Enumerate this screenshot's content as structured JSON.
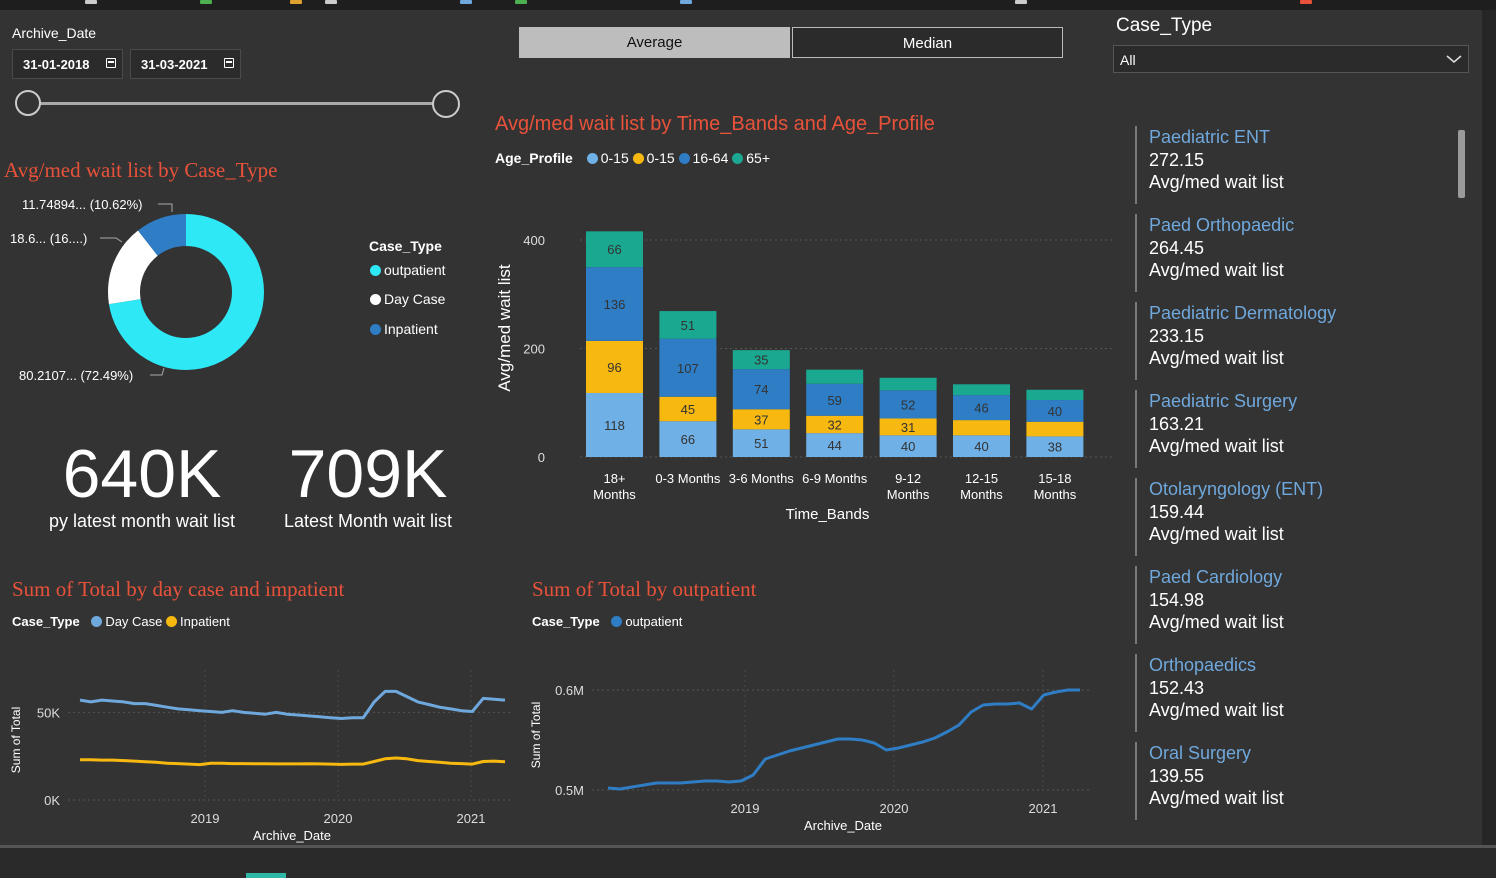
{
  "filters": {
    "archive_date_label": "Archive_Date",
    "start_date": "31-01-2018",
    "end_date": "31-03-2021",
    "toggle_average": "Average",
    "toggle_median": "Median",
    "case_type_label": "Case_Type",
    "case_type_value": "All"
  },
  "donut": {
    "title": "Avg/med wait list by Case_Type",
    "legend_title": "Case_Type",
    "legend": [
      {
        "name": "outpatient",
        "color": "#2ee8f5"
      },
      {
        "name": "Day Case",
        "color": "#ffffff"
      },
      {
        "name": "Inpatient",
        "color": "#2f7dc4"
      }
    ],
    "labels": {
      "inpatient": "11.74894... (10.62%)",
      "daycase": "18.6... (16....)",
      "outpatient": "80.2107... (72.49%)"
    }
  },
  "kpis": [
    {
      "value": "640K",
      "label": "py latest month wait list"
    },
    {
      "value": "709K",
      "label": "Latest Month wait list"
    }
  ],
  "chart_data": [
    {
      "type": "bar",
      "stacked": true,
      "title": "Avg/med wait list by Time_Bands and Age_Profile",
      "legend_title": "Age_Profile",
      "xlabel": "Time_Bands",
      "ylabel": "Avg/med wait list",
      "ylim": [
        0,
        420
      ],
      "yticks": [
        "0",
        "200",
        "400"
      ],
      "categories": [
        "18+ Months",
        "0-3 Months",
        "3-6 Months",
        "6-9 Months",
        "9-12 Months",
        "12-15 Months",
        "15-18 Months"
      ],
      "category_lines": [
        [
          "18+",
          "Months"
        ],
        [
          "0-3 Months"
        ],
        [
          "3-6 Months"
        ],
        [
          "6-9 Months"
        ],
        [
          "9-12",
          "Months"
        ],
        [
          "12-15",
          "Months"
        ],
        [
          "15-18",
          "Months"
        ]
      ],
      "series": [
        {
          "name": "0-15",
          "color": "#6fb0e6",
          "values": [
            118,
            66,
            51,
            44,
            40,
            40,
            38
          ]
        },
        {
          "name": "0-15",
          "color": "#f7b80f",
          "values": [
            96,
            45,
            37,
            32,
            31,
            28,
            27
          ]
        },
        {
          "name": "16-64",
          "color": "#2f7dc4",
          "values": [
            136,
            107,
            74,
            59,
            52,
            46,
            40
          ]
        },
        {
          "name": "65+",
          "color": "#1ba890",
          "values": [
            66,
            51,
            35,
            26,
            23,
            20,
            19
          ]
        }
      ],
      "labels": [
        [
          "118",
          "96",
          "136",
          "66"
        ],
        [
          "66",
          "45",
          "107",
          "51"
        ],
        [
          "51",
          "37",
          "74",
          "35"
        ],
        [
          "44",
          "32",
          "59",
          ""
        ],
        [
          "40",
          "31",
          "52",
          ""
        ],
        [
          "40",
          "",
          "46",
          ""
        ],
        [
          "38",
          "",
          "40",
          ""
        ]
      ],
      "grid": true
    },
    {
      "type": "line",
      "title": "Sum of Total by day case and impatient",
      "legend_title": "Case_Type",
      "xlabel": "Archive_Date",
      "ylabel": "Sum of Total",
      "ylim": [
        0,
        75000
      ],
      "yticks": [
        "0K",
        "50K"
      ],
      "xticks": [
        "2019",
        "2020",
        "2021"
      ],
      "x_start": "2018-01",
      "x_end": "2021-03",
      "series": [
        {
          "name": "Day Case",
          "color": "#6fa8dc",
          "values": [
            57000,
            56000,
            57000,
            56500,
            56000,
            55000,
            55000,
            54000,
            53000,
            52000,
            51500,
            51000,
            50500,
            50000,
            51000,
            50000,
            49500,
            49000,
            50000,
            49000,
            48500,
            48000,
            47500,
            47000,
            46500,
            47000,
            47000,
            56000,
            62000,
            62000,
            59000,
            56000,
            54500,
            53000,
            52000,
            51000,
            50500,
            58000,
            57500,
            57000
          ]
        },
        {
          "name": "Inpatient",
          "color": "#f7b80f",
          "values": [
            23000,
            23000,
            22800,
            22800,
            22500,
            22200,
            21800,
            21500,
            21000,
            20800,
            20500,
            20200,
            21000,
            21000,
            20800,
            20800,
            20700,
            20700,
            20600,
            20600,
            20600,
            20700,
            20600,
            20500,
            20300,
            20500,
            20500,
            22000,
            23500,
            24000,
            23500,
            22500,
            22000,
            21500,
            21000,
            20800,
            20500,
            22000,
            22200,
            21800
          ]
        }
      ],
      "grid": true
    },
    {
      "type": "line",
      "title": "Sum of Total by outpatient",
      "legend_title": "Case_Type",
      "xlabel": "Archive_Date",
      "ylabel": "Sum of Total",
      "ylim": [
        0.48,
        0.65
      ],
      "y_unit": "M",
      "yticks": [
        "0.5M",
        "0.6M"
      ],
      "xticks": [
        "2019",
        "2020",
        "2021"
      ],
      "x_start": "2018-01",
      "x_end": "2021-03",
      "series": [
        {
          "name": "outpatient",
          "color": "#2f7dc4",
          "values": [
            0.502,
            0.501,
            0.503,
            0.505,
            0.507,
            0.507,
            0.507,
            0.508,
            0.509,
            0.509,
            0.508,
            0.509,
            0.515,
            0.531,
            0.535,
            0.539,
            0.542,
            0.545,
            0.548,
            0.551,
            0.551,
            0.55,
            0.547,
            0.54,
            0.542,
            0.545,
            0.548,
            0.552,
            0.558,
            0.565,
            0.578,
            0.585,
            0.586,
            0.586,
            0.587,
            0.581,
            0.595,
            0.598,
            0.6,
            0.6
          ]
        }
      ],
      "grid": true
    }
  ],
  "cards": [
    {
      "title": "Paediatric ENT",
      "value": "272.15",
      "sub": "Avg/med wait list"
    },
    {
      "title": "Paed Orthopaedic",
      "value": "264.45",
      "sub": "Avg/med wait list"
    },
    {
      "title": "Paediatric Dermatology",
      "value": "233.15",
      "sub": "Avg/med wait list"
    },
    {
      "title": "Paediatric Surgery",
      "value": "163.21",
      "sub": "Avg/med wait list"
    },
    {
      "title": "Otolaryngology (ENT)",
      "value": "159.44",
      "sub": "Avg/med wait list"
    },
    {
      "title": "Paed Cardiology",
      "value": "154.98",
      "sub": "Avg/med wait list"
    },
    {
      "title": "Orthopaedics",
      "value": "152.43",
      "sub": "Avg/med wait list"
    },
    {
      "title": "Oral Surgery",
      "value": "139.55",
      "sub": "Avg/med wait list"
    }
  ]
}
